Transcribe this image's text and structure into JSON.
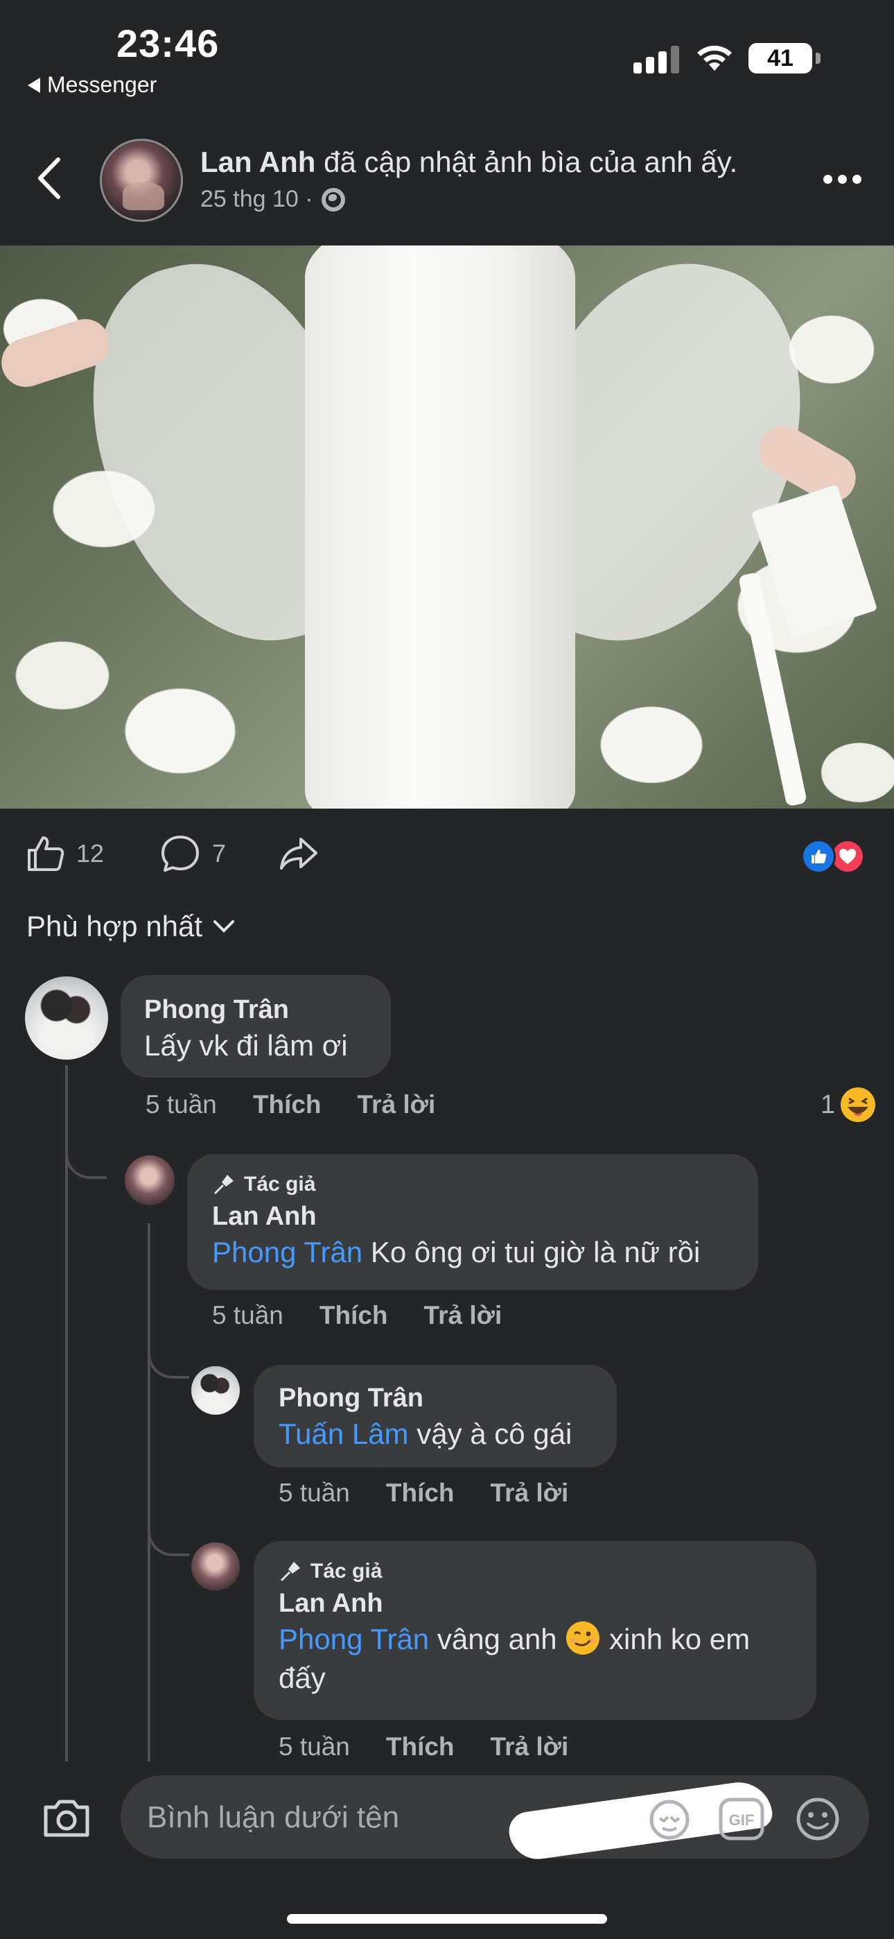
{
  "status_bar": {
    "time": "23:46",
    "back_app": "Messenger",
    "battery": "41"
  },
  "post": {
    "author": "Lan Anh",
    "action": "đã cập nhật ảnh bìa của anh ấy.",
    "date": "25 thg 10 ·",
    "privacy_icon": "globe-icon"
  },
  "actions": {
    "likes": "12",
    "comments": "7"
  },
  "sort": {
    "label": "Phù hợp nhất"
  },
  "comments": [
    {
      "name": "Phong Trân",
      "text": "Lấy vk đi lâm ơi",
      "time": "5 tuần",
      "like": "Thích",
      "reply": "Trả lời",
      "reaction_count": "1"
    },
    {
      "badge": "Tác giả",
      "name": "Lan Anh",
      "mention": "Phong Trân",
      "text": " Ko ông ơi tui giờ là nữ rồi",
      "time": "5 tuần",
      "like": "Thích",
      "reply": "Trả lời"
    },
    {
      "name": "Phong Trân",
      "mention": "Tuấn Lâm",
      "text": " vậy à cô gái",
      "time": "5 tuần",
      "like": "Thích",
      "reply": "Trả lời"
    },
    {
      "badge": "Tác giả",
      "name": "Lan Anh",
      "mention": "Phong Trân",
      "text_a": " vâng anh ",
      "text_b": " xinh ko em",
      "text_c": "đấy",
      "time": "5 tuần",
      "like": "Thích",
      "reply": "Trả lời"
    }
  ],
  "composer": {
    "placeholder": "Bình luận dưới tên"
  },
  "colors": {
    "background": "#242526",
    "bubble": "#3a3b3c",
    "mention": "#4599ff",
    "like_blue": "#1b74e4",
    "love_red": "#f33e58"
  }
}
